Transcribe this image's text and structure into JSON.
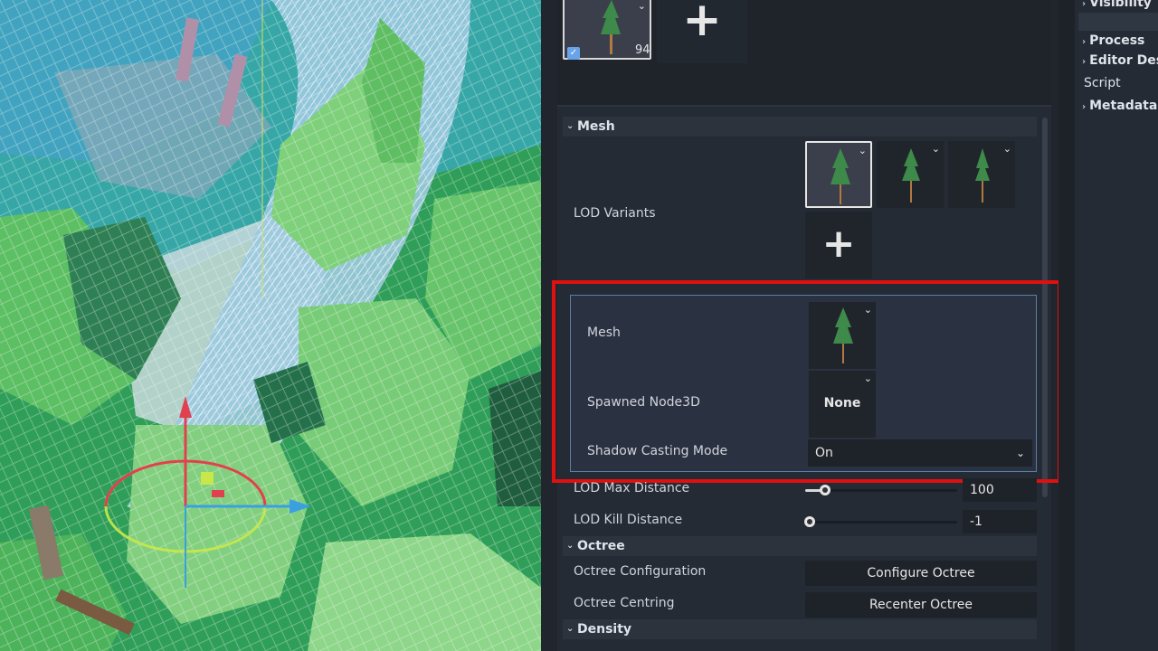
{
  "top_strip": {
    "mesh_count": "94",
    "checked_icon": "check-icon",
    "add_icon": "plus-icon"
  },
  "mesh_section": {
    "header": "Mesh",
    "lod_variants_label": "LOD Variants",
    "add_icon": "plus-icon"
  },
  "lod_editor": {
    "mesh_label": "Mesh",
    "spawned_label": "Spawned Node3D",
    "spawned_value": "None",
    "shadow_label": "Shadow Casting Mode",
    "shadow_value": "On"
  },
  "lod_distances": {
    "max_label": "LOD Max Distance",
    "max_value": "100",
    "max_level": 0.13,
    "kill_label": "LOD Kill Distance",
    "kill_value": "-1",
    "kill_level": 0.0
  },
  "octree_section": {
    "header": "Octree",
    "config_label": "Octree Configuration",
    "config_button": "Configure Octree",
    "centring_label": "Octree Centring",
    "centring_button": "Recenter Octree"
  },
  "density_section": {
    "header": "Density"
  },
  "right_dock": {
    "visibility": "Visibility",
    "process": "Process",
    "editor_desc": "Editor Desc",
    "script": "Script",
    "metadata": "Metadata"
  },
  "colors": {
    "highlight": "#e01010",
    "accent": "#6aa4e8"
  }
}
